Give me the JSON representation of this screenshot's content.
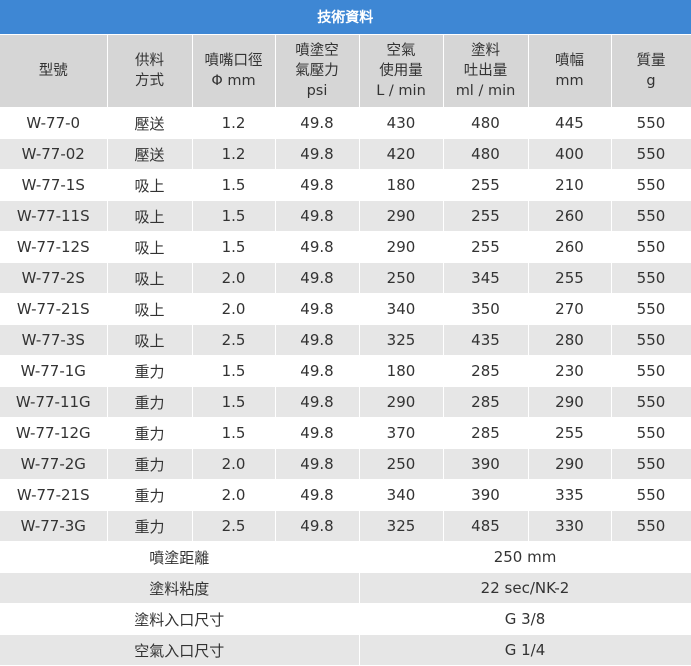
{
  "title": "技術資料",
  "headers": [
    [
      "型號"
    ],
    [
      "供料",
      "方式"
    ],
    [
      "噴嘴口徑",
      "Φ mm"
    ],
    [
      "噴塗空",
      "氣壓力",
      "psi"
    ],
    [
      "空氣",
      "使用量",
      "L / min"
    ],
    [
      "塗料",
      "吐出量",
      "ml / min"
    ],
    [
      "噴幅",
      "mm"
    ],
    [
      "質量",
      "g"
    ]
  ],
  "rows": [
    [
      "W-77-0",
      "壓送",
      "1.2",
      "49.8",
      "430",
      "480",
      "445",
      "550"
    ],
    [
      "W-77-02",
      "壓送",
      "1.2",
      "49.8",
      "420",
      "480",
      "400",
      "550"
    ],
    [
      "W-77-1S",
      "吸上",
      "1.5",
      "49.8",
      "180",
      "255",
      "210",
      "550"
    ],
    [
      "W-77-11S",
      "吸上",
      "1.5",
      "49.8",
      "290",
      "255",
      "260",
      "550"
    ],
    [
      "W-77-12S",
      "吸上",
      "1.5",
      "49.8",
      "290",
      "255",
      "260",
      "550"
    ],
    [
      "W-77-2S",
      "吸上",
      "2.0",
      "49.8",
      "250",
      "345",
      "255",
      "550"
    ],
    [
      "W-77-21S",
      "吸上",
      "2.0",
      "49.8",
      "340",
      "350",
      "270",
      "550"
    ],
    [
      "W-77-3S",
      "吸上",
      "2.5",
      "49.8",
      "325",
      "435",
      "280",
      "550"
    ],
    [
      "W-77-1G",
      "重力",
      "1.5",
      "49.8",
      "180",
      "285",
      "230",
      "550"
    ],
    [
      "W-77-11G",
      "重力",
      "1.5",
      "49.8",
      "290",
      "285",
      "290",
      "550"
    ],
    [
      "W-77-12G",
      "重力",
      "1.5",
      "49.8",
      "370",
      "285",
      "255",
      "550"
    ],
    [
      "W-77-2G",
      "重力",
      "2.0",
      "49.8",
      "250",
      "390",
      "290",
      "550"
    ],
    [
      "W-77-21S",
      "重力",
      "2.0",
      "49.8",
      "340",
      "390",
      "335",
      "550"
    ],
    [
      "W-77-3G",
      "重力",
      "2.5",
      "49.8",
      "325",
      "485",
      "330",
      "550"
    ]
  ],
  "footer": [
    {
      "label": "噴塗距離",
      "value": "250 mm"
    },
    {
      "label": "塗料粘度",
      "value": "22 sec/NK-2"
    },
    {
      "label": "塗料入口尺寸",
      "value": "G 3/8"
    },
    {
      "label": "空氣入口尺寸",
      "value": "G 1/4"
    }
  ]
}
